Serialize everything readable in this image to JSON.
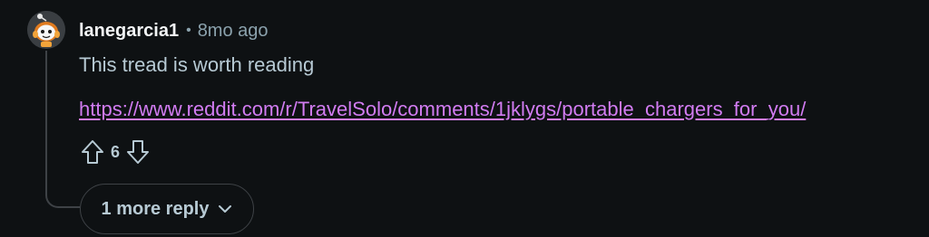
{
  "comment": {
    "author": "lanegarcia1",
    "separator": "•",
    "timestamp": "8mo ago",
    "text": "This tread is worth reading",
    "link": {
      "text": "https://www.reddit.com/r/TravelSolo/comments/1jklygs/portable_chargers_for_you/",
      "href": "https://www.reddit.com/r/TravelSolo/comments/1jklygs/portable_chargers_for_you/"
    },
    "score": "6",
    "upvote_icon": "upvote-arrow-icon",
    "downvote_icon": "downvote-arrow-icon"
  },
  "replies": {
    "more_label": "1 more reply",
    "chevron_icon": "chevron-down-icon"
  },
  "colors": {
    "background": "#0e1113",
    "username": "#f2f4f5",
    "meta": "#8ba2ad",
    "body": "#b7cad4",
    "link": "#d27cf2",
    "border": "#3e4246"
  }
}
